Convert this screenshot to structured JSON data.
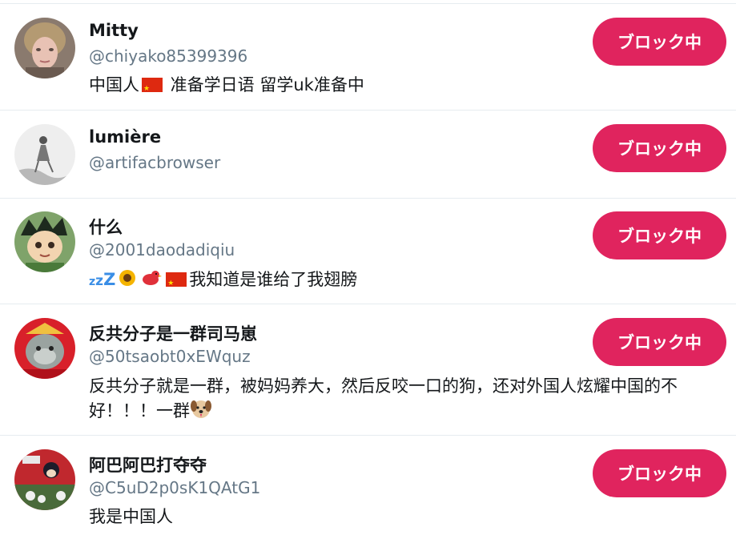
{
  "block_label": "ブロック中",
  "accounts": [
    {
      "name": "Mitty",
      "handle": "@chiyako85399396",
      "bio_before_flag": "中国人",
      "bio_after_flag": " 准备学日语 留学uk准备中"
    },
    {
      "name": "lumière",
      "handle": "@artifacbrowser"
    },
    {
      "name": "什么",
      "handle": "@2001daodadiqiu",
      "bio_text": "我知道是谁给了我翅膀"
    },
    {
      "name": "反共分子是一群司马崽",
      "handle": "@50tsaobt0xEWquz",
      "bio_text": "反共分子就是一群，被妈妈养大，然后反咬一口的狗，还对外国人炫耀中国的不好！！！一群"
    },
    {
      "name": "阿巴阿巴打夺夺",
      "handle": "@C5uD2p0sK1QAtG1",
      "bio_text": "我是中国人"
    }
  ],
  "colors": {
    "block_button": "#e0245e",
    "handle_text": "#657786",
    "divider": "#e6ecf0"
  }
}
